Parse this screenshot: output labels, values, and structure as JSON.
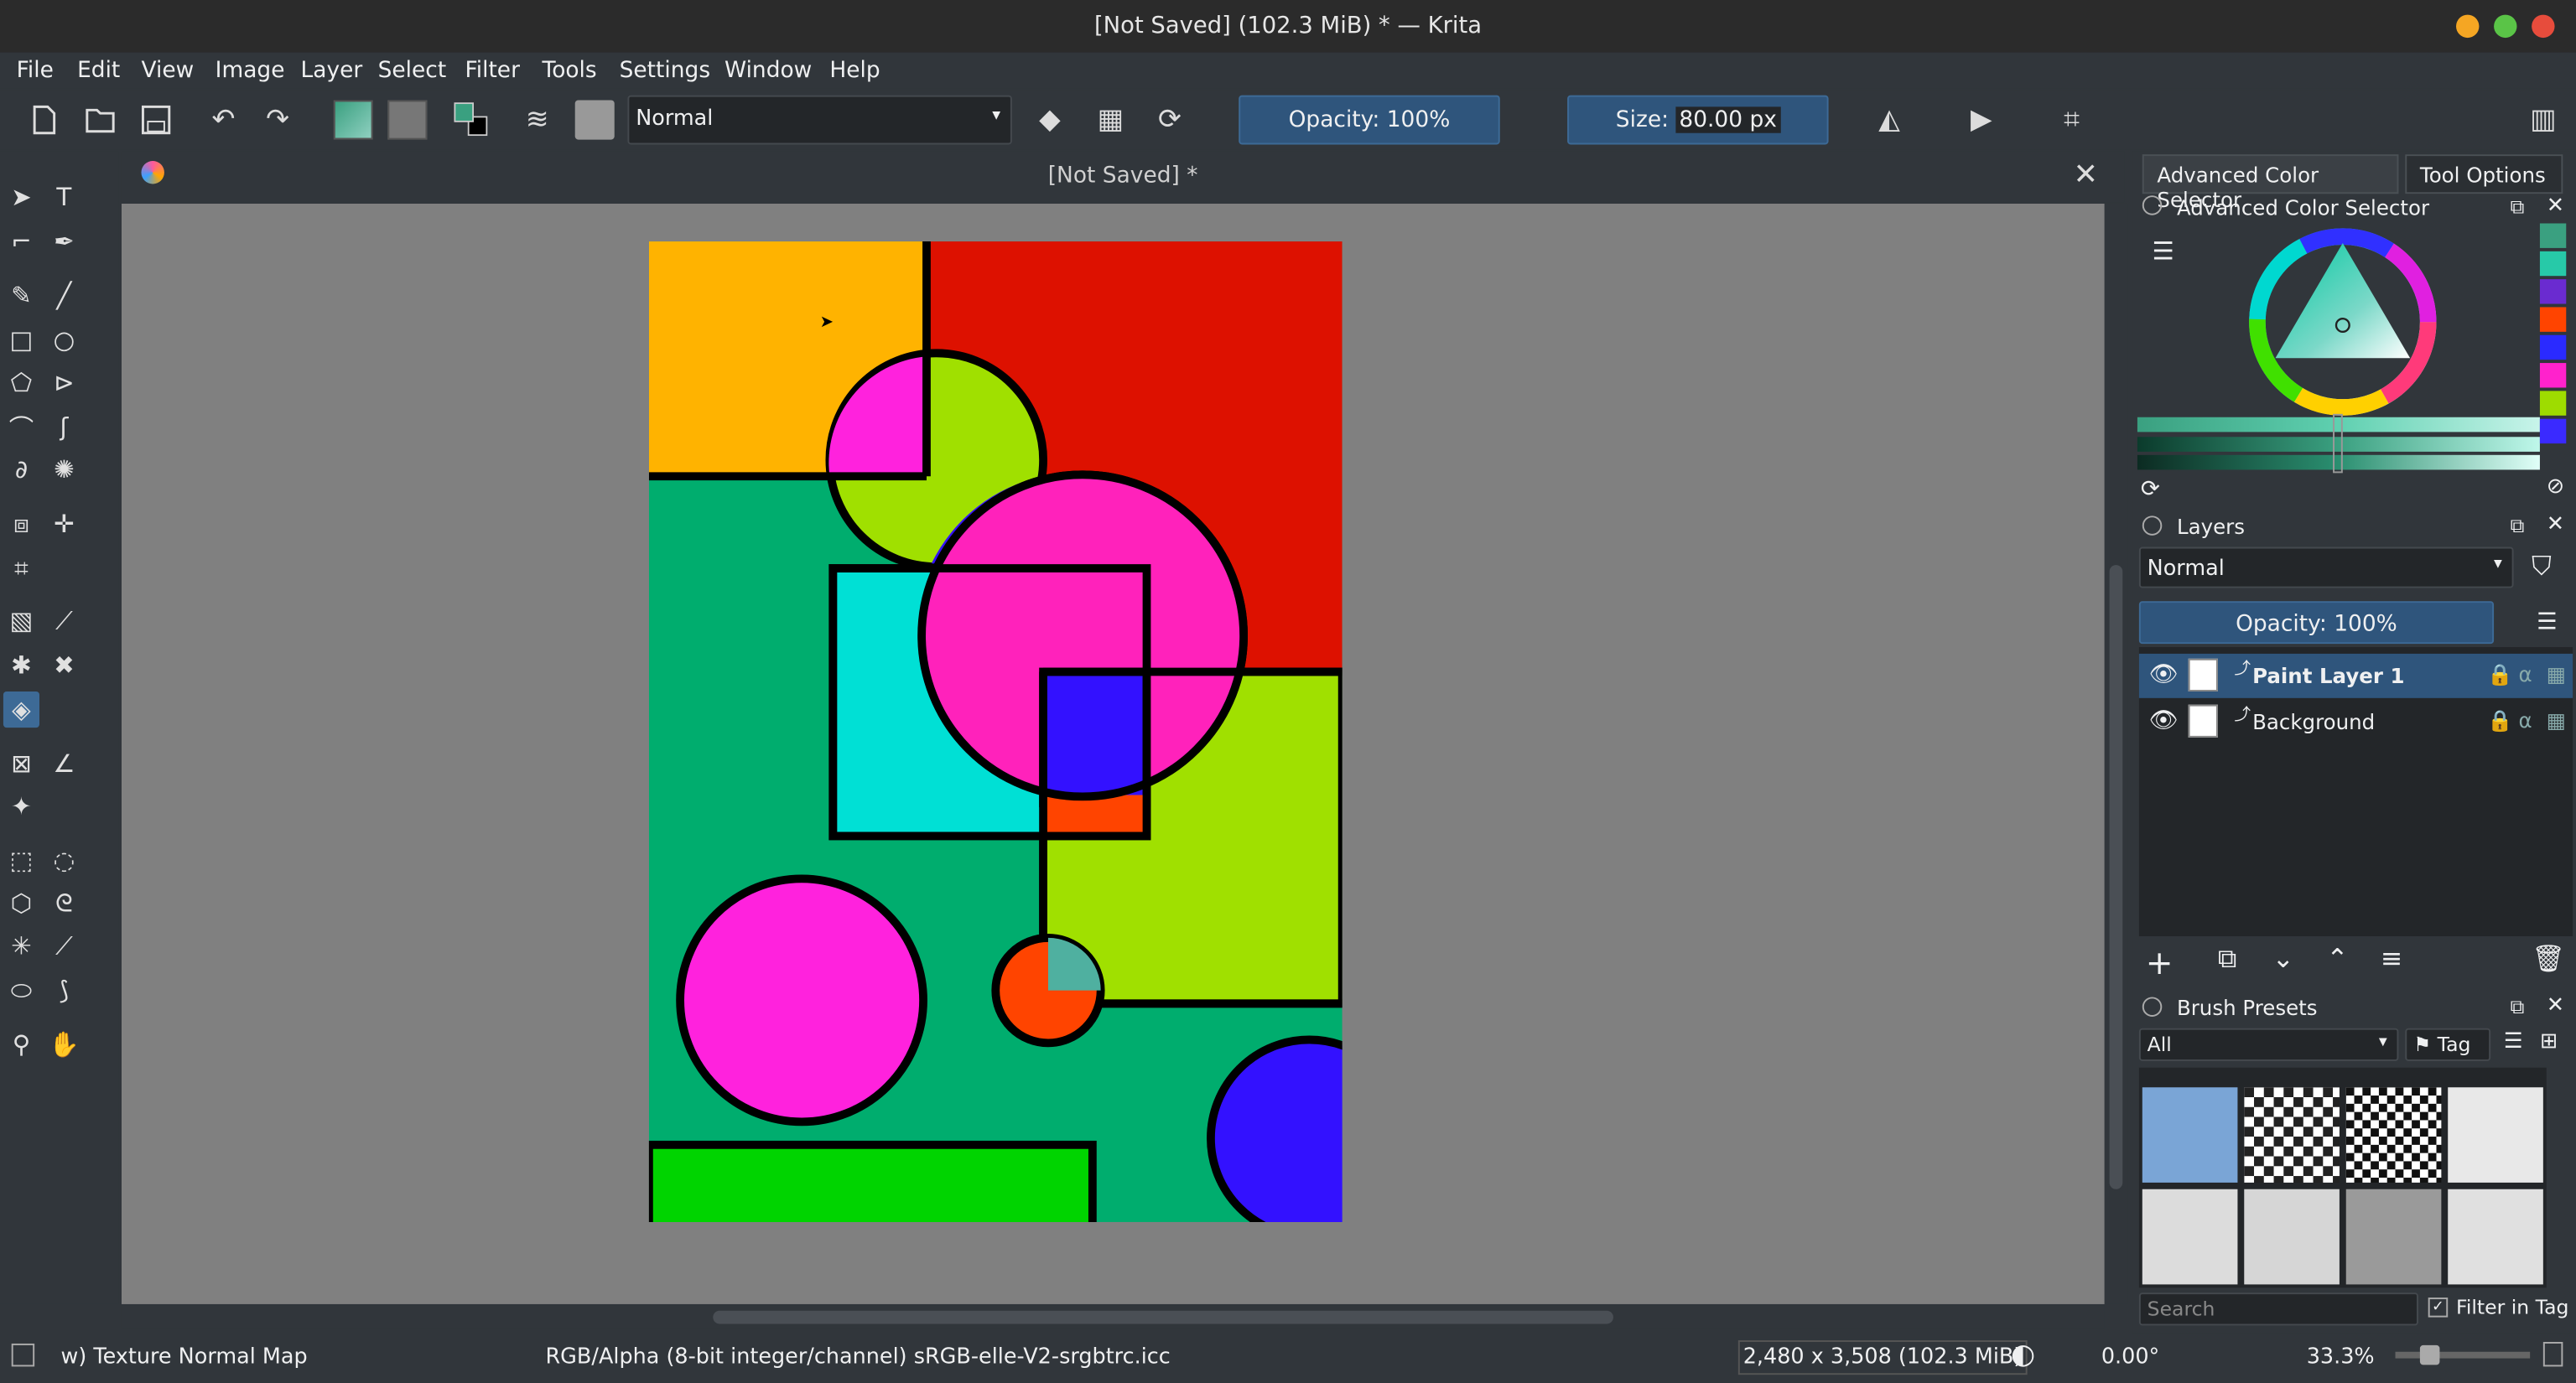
{
  "window": {
    "title": "[Not Saved]  (102.3 MiB)  * — Krita"
  },
  "menu": [
    "File",
    "Edit",
    "View",
    "Image",
    "Layer",
    "Select",
    "Filter",
    "Tools",
    "Settings",
    "Window",
    "Help"
  ],
  "toolbar": {
    "blend_mode": "Normal",
    "opacity_label": "Opacity: 100%",
    "size_label": "Size:",
    "size_value": "80.00 px"
  },
  "document": {
    "tab_title": "[Not Saved]  *"
  },
  "docker": {
    "tabs": [
      "Advanced Color Selector",
      "Tool Options"
    ],
    "color_selector_title": "Advanced Color Selector",
    "layers_title": "Layers",
    "layers_blend": "Normal",
    "layers_opacity": "Opacity:  100%",
    "layers": [
      {
        "name": "Paint Layer 1",
        "selected": true
      },
      {
        "name": "Background",
        "selected": false
      }
    ],
    "brush_presets_title": "Brush Presets",
    "brush_filter": "All",
    "tag_label": "Tag",
    "search_placeholder": "Search",
    "filter_in_tag": "Filter in Tag"
  },
  "status": {
    "brush": "w) Texture Normal Map",
    "color_space": "RGB/Alpha (8-bit integer/channel)  sRGB-elle-V2-srgbtrc.icc",
    "dimensions": "2,480 x 3,508 (102.3 MiB)",
    "rotation": "0.00°",
    "zoom": "33.3%"
  },
  "colors": {
    "accent": "#2f557c",
    "fg_swatch": "#3aa080",
    "bg_swatch": "#000000",
    "canvas_bg": "#808080"
  },
  "side_swatches": [
    "#3aa080",
    "#27c9a8",
    "#6a2bd0",
    "#ff4400",
    "#2a2aff",
    "#ff22cc",
    "#9edc00",
    "#3a2aff"
  ]
}
